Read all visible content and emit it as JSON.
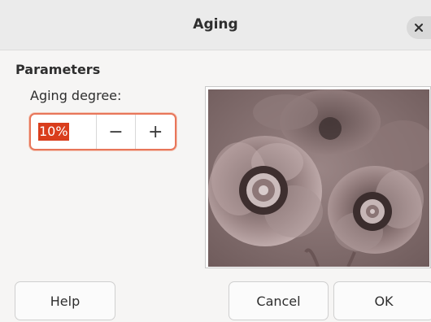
{
  "dialog": {
    "title": "Aging",
    "close_icon": "close-icon"
  },
  "parameters": {
    "section_title": "Parameters",
    "aging_degree_label": "Aging degree:",
    "aging_degree_value": "10%",
    "decrement_symbol": "−",
    "increment_symbol": "+"
  },
  "preview": {
    "icon": "poppy-preview-image",
    "tone_color": "#8a6f6f"
  },
  "buttons": {
    "help": "Help",
    "cancel": "Cancel",
    "ok": "OK"
  },
  "colors": {
    "focus_border": "#e8765a",
    "selection": "#d93d1c"
  }
}
